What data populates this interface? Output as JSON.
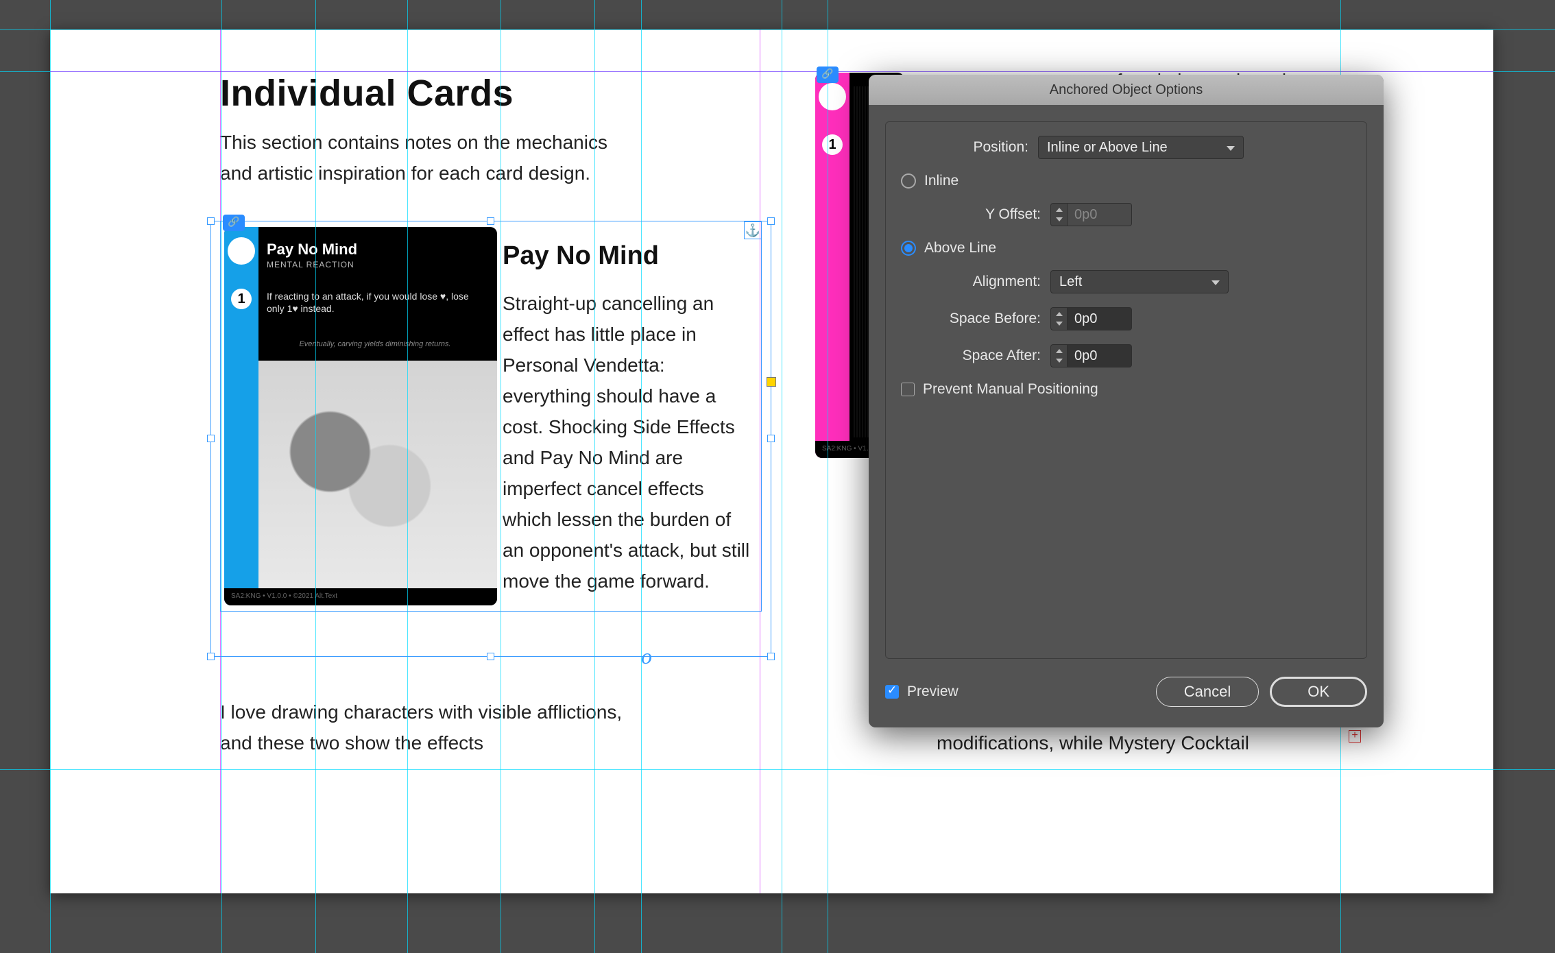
{
  "document": {
    "heading": "Individual Cards",
    "intro": "This section contains notes on the mechanics and artistic inspiration for each card design.",
    "subheading": "Pay No Mind",
    "body": "Straight-up cancelling an effect has little place in Personal Vendetta: everything should have a cost. Shocking Side Effects and Pay No Mind are imperfect cancel effects which lessen the burden of an opponent's attack, but still move the game forward.",
    "cont1": "I love drawing characters with visible afflictions, and these two show the effects",
    "right_top": "of sculpting and carving",
    "right_bottom": "modifications, while Mystery Cocktail"
  },
  "card": {
    "title": "Pay No Mind",
    "subtitle": "MENTAL REACTION",
    "cost": "1",
    "rules": "If reacting to an attack, if you would lose ♥, lose only 1♥ instead.",
    "flavor": "Eventually, carving yields diminishing returns.",
    "footer": "SA2:KNG • V1.0.0 • ©2021 Alt.Text"
  },
  "card2": {
    "cost": "1",
    "footer": "SA2:KNG • V1…"
  },
  "dialog": {
    "title": "Anchored Object Options",
    "position_label": "Position:",
    "position_value": "Inline or Above Line",
    "inline_label": "Inline",
    "y_offset_label": "Y Offset:",
    "y_offset_value": "0p0",
    "above_line_label": "Above Line",
    "alignment_label": "Alignment:",
    "alignment_value": "Left",
    "space_before_label": "Space Before:",
    "space_before_value": "0p0",
    "space_after_label": "Space After:",
    "space_after_value": "0p0",
    "prevent_label": "Prevent Manual Positioning",
    "preview_label": "Preview",
    "cancel": "Cancel",
    "ok": "OK"
  }
}
